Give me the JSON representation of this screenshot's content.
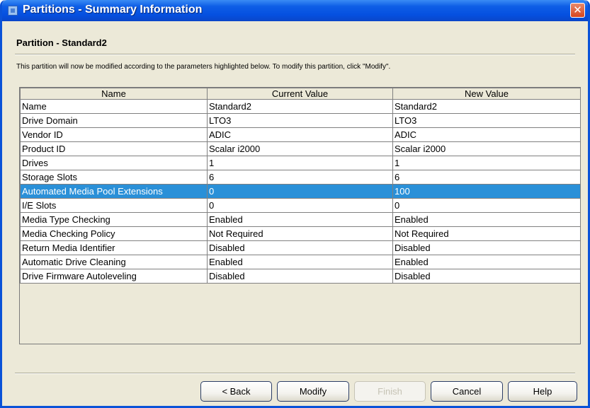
{
  "window": {
    "title": "Partitions - Summary Information",
    "close_label": "✕"
  },
  "heading": "Partition - Standard2",
  "description": "This partition will now be modified according to the parameters highlighted below. To modify this partition, click \"Modify\".",
  "table": {
    "columns": [
      "Name",
      "Current Value",
      "New Value"
    ],
    "rows": [
      [
        "Name",
        "Standard2",
        "Standard2"
      ],
      [
        "Drive Domain",
        "LTO3",
        "LTO3"
      ],
      [
        "Vendor ID",
        "ADIC",
        "ADIC"
      ],
      [
        "Product ID",
        "Scalar i2000",
        "Scalar i2000"
      ],
      [
        "Drives",
        "1",
        "1"
      ],
      [
        "Storage Slots",
        "6",
        "6"
      ],
      [
        "Automated Media Pool Extensions",
        "0",
        "100"
      ],
      [
        "I/E Slots",
        "0",
        "0"
      ],
      [
        "Media Type Checking",
        "Enabled",
        "Enabled"
      ],
      [
        "Media Checking Policy",
        "Not Required",
        "Not Required"
      ],
      [
        "Return Media Identifier",
        "Disabled",
        "Disabled"
      ],
      [
        "Automatic Drive Cleaning",
        "Enabled",
        "Enabled"
      ],
      [
        "Drive Firmware Autoleveling",
        "Disabled",
        "Disabled"
      ]
    ]
  },
  "buttons": {
    "back": "< Back",
    "modify": "Modify",
    "finish": "Finish",
    "cancel": "Cancel",
    "help": "Help"
  },
  "colors": {
    "highlight": "#2a90d8",
    "titlebar": "#0550e0",
    "dialog_bg": "#ece9d8"
  }
}
